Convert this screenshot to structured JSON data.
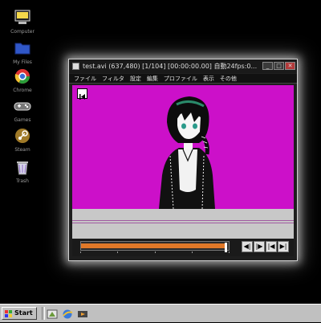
{
  "desktop": {
    "icons": [
      {
        "label": "Computer",
        "icon": "computer-icon"
      },
      {
        "label": "My Files",
        "icon": "folder-icon"
      },
      {
        "label": "Chrome",
        "icon": "chrome-icon"
      },
      {
        "label": "Games",
        "icon": "gamepad-icon"
      },
      {
        "label": "Steam",
        "icon": "steam-icon"
      },
      {
        "label": "Trash",
        "icon": "trash-icon"
      }
    ]
  },
  "window": {
    "title": "test.avi (637,480)  [1/104] [00:00:00.00]  自動24fps:0...",
    "controls": {
      "minimize": "_",
      "maximize": "□",
      "close": "✕"
    },
    "menu": [
      "ファイル",
      "フィルタ",
      "設定",
      "編集",
      "プロファイル",
      "表示",
      "その他"
    ],
    "video": {
      "background": "#cc10c9",
      "frame": 1,
      "total_frames": 104
    },
    "seek": {
      "progress_fraction": 0.98
    },
    "nav_buttons": [
      {
        "label": "◀|",
        "icon": "step-back-icon"
      },
      {
        "label": "|▶",
        "icon": "step-forward-icon"
      },
      {
        "label": "|◀",
        "icon": "jump-prev-icon"
      },
      {
        "label": "▶|",
        "icon": "jump-next-icon"
      }
    ]
  },
  "taskbar": {
    "start_label": "Start",
    "quicklaunch": [
      "show-desktop-icon",
      "browser-icon",
      "media-icon"
    ]
  },
  "colors": {
    "accent": "#e07828",
    "magenta": "#cc10c9"
  }
}
